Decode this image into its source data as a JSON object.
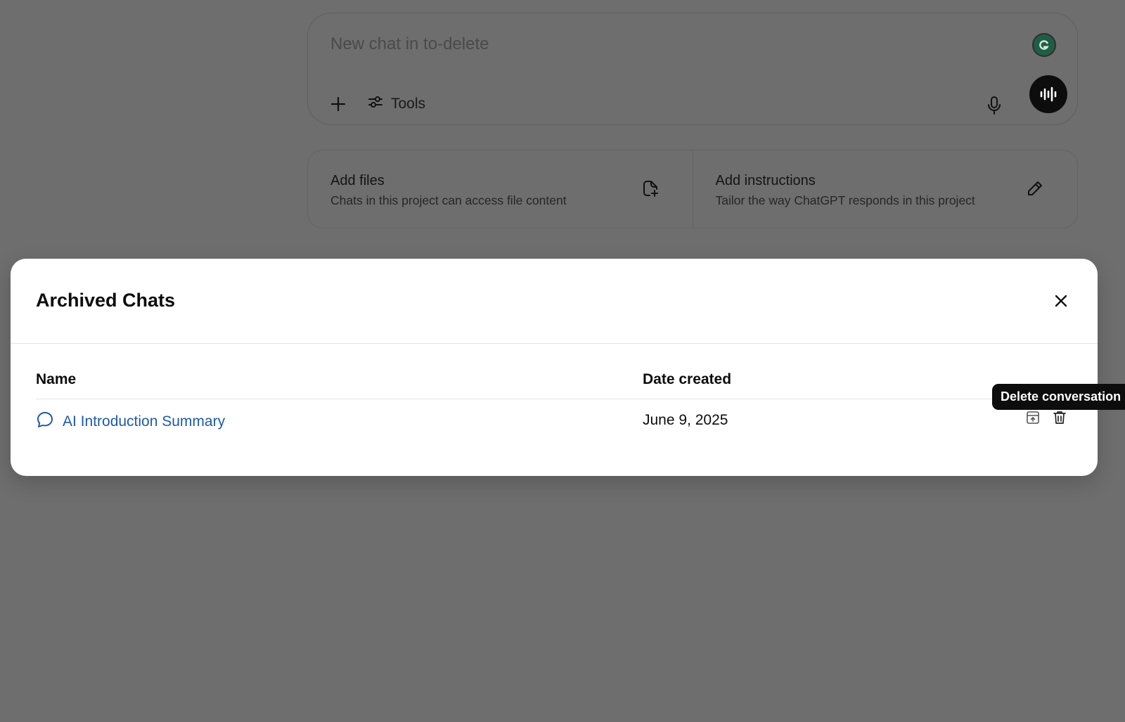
{
  "composer": {
    "placeholder": "New chat in to-delete",
    "tools_label": "Tools"
  },
  "cards": [
    {
      "title": "Add files",
      "subtitle": "Chats in this project can access file content"
    },
    {
      "title": "Add instructions",
      "subtitle": "Tailor the way ChatGPT responds in this project"
    }
  ],
  "modal": {
    "title": "Archived Chats",
    "columns": {
      "name": "Name",
      "date": "Date created"
    },
    "rows": [
      {
        "name": "AI Introduction Summary",
        "date": "June 9, 2025"
      }
    ]
  },
  "tooltip": {
    "text": "Delete conversation"
  },
  "colors": {
    "overlay": "#6e6e6e",
    "link": "#1f5aa8",
    "tooltip_bg": "#0d0d0d",
    "voice_button": "#0d0d0d"
  },
  "icons": {
    "composer_grammarly": "grammarly-icon",
    "composer_plus": "plus-icon",
    "composer_tools": "sliders-icon",
    "composer_mic": "microphone-icon",
    "composer_voice": "voice-waveform-icon",
    "card_files": "file-add-icon",
    "card_instructions": "pencil-icon",
    "close": "close-icon",
    "row_chat": "chat-bubble-icon",
    "row_unarchive": "unarchive-icon",
    "row_delete": "trash-icon"
  }
}
